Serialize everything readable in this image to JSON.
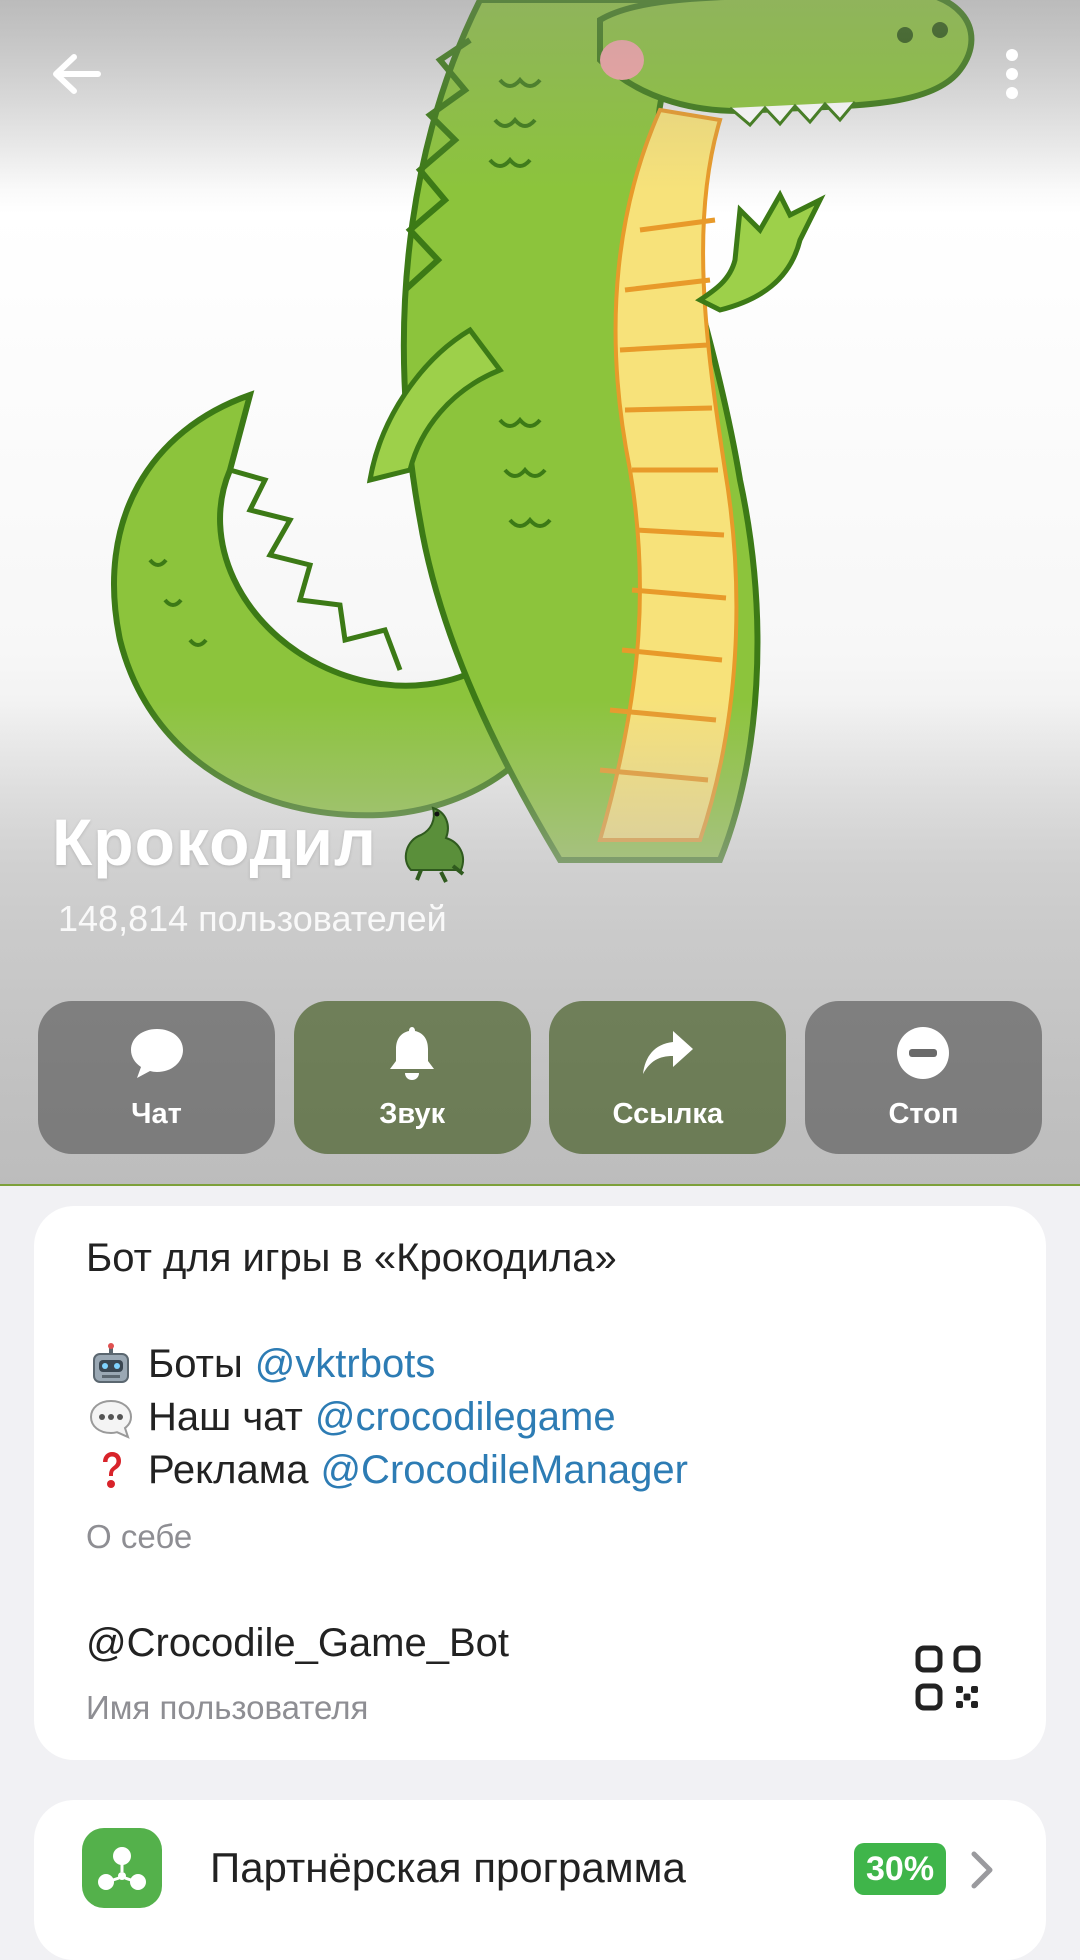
{
  "header": {
    "back_icon": "arrow-left-icon",
    "more_icon": "dots-vertical-icon"
  },
  "profile": {
    "name": "Крокодил",
    "name_emoji": "crocodile-emoji",
    "subscribers": "148,814 пользователей"
  },
  "actions": [
    {
      "label": "Чат",
      "icon": "chat-bubble-icon"
    },
    {
      "label": "Звук",
      "icon": "bell-icon"
    },
    {
      "label": "Ссылка",
      "icon": "share-arrow-icon"
    },
    {
      "label": "Стоп",
      "icon": "stop-circle-icon"
    }
  ],
  "about": {
    "title": "Бот для игры в «Крокодила»",
    "lines": [
      {
        "emoji": "robot-emoji",
        "text": "Боты",
        "link": "@vktrbots"
      },
      {
        "emoji": "speech-bubble-emoji",
        "text": "Наш чат",
        "link": "@crocodilegame"
      },
      {
        "emoji": "red-question-mark-emoji",
        "text": "Реклама",
        "link": "@CrocodileManager"
      }
    ],
    "caption": "О себе"
  },
  "username": {
    "value": "@Crocodile_Game_Bot",
    "caption": "Имя пользователя",
    "qr_icon": "qr-code-icon"
  },
  "partner": {
    "label": "Партнёрская программа",
    "badge": "30%",
    "icon": "affiliate-network-icon"
  },
  "colors": {
    "accent_link": "#2d7cb4",
    "badge_green": "#3fb54a",
    "crocodile_green": "#8cc43c",
    "belly_yellow": "#f7e27a"
  }
}
